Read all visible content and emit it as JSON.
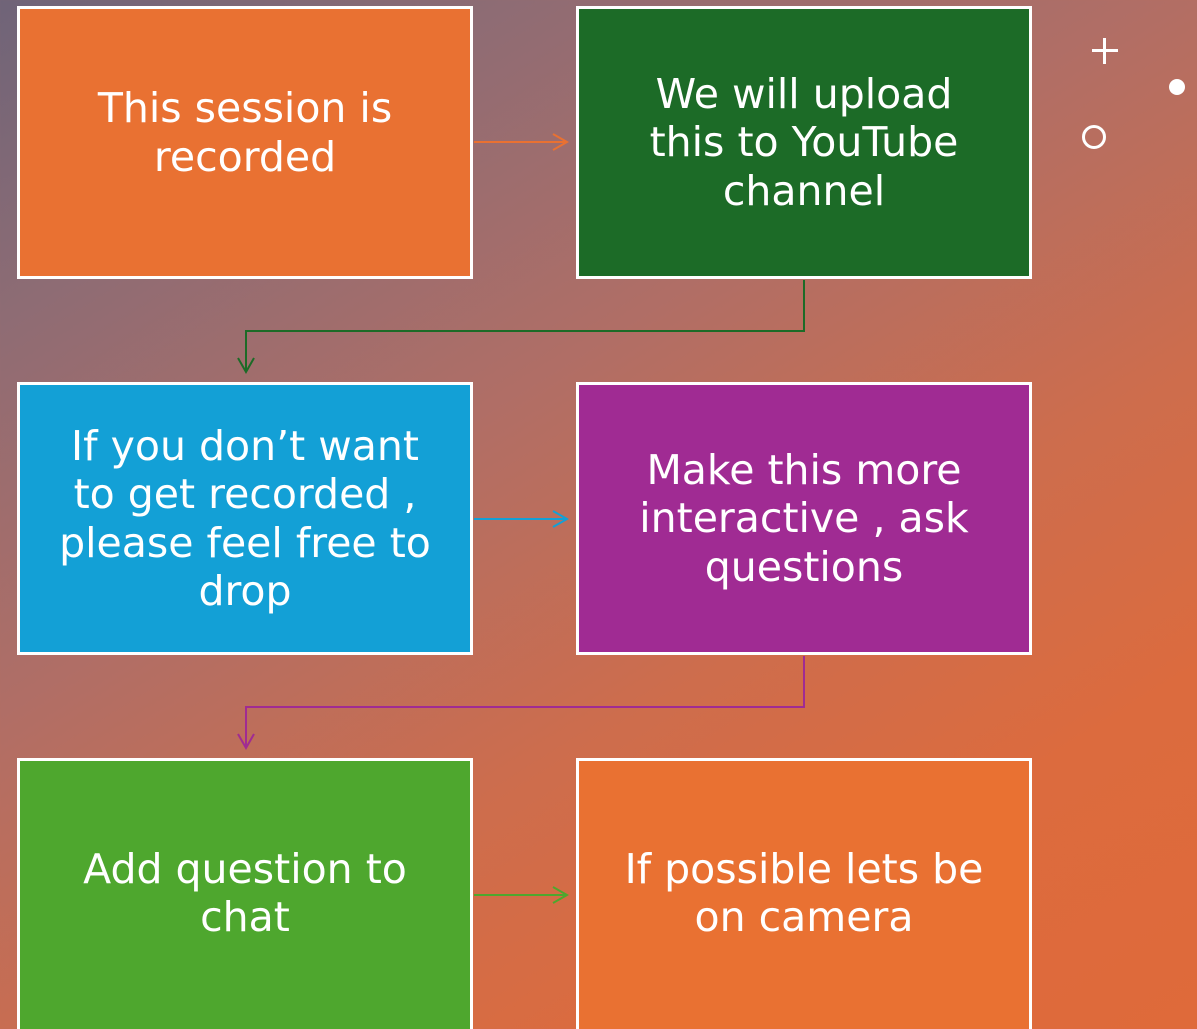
{
  "boxes": [
    {
      "text": "This session is\nrecorded",
      "color": "#e97132"
    },
    {
      "text": "We will upload\nthis to YouTube\nchannel",
      "color": "#1c6b27"
    },
    {
      "text": "If you don’t want\nto get recorded ,\nplease feel free to\ndrop",
      "color": "#13a0d6"
    },
    {
      "text": "Make this more\ninteractive , ask\nquestions",
      "color": "#a02b93"
    },
    {
      "text": "Add question to\nchat",
      "color": "#4ea72e"
    },
    {
      "text": "If possible lets be\non camera",
      "color": "#e97132"
    }
  ],
  "connector_colors": {
    "box1_to_box2": "#e97132",
    "box2_to_box3": "#1c6b27",
    "box3_to_box4": "#13a0d6",
    "box4_to_box5": "#a02b93",
    "box5_to_box6": "#4ea72e"
  },
  "decorations": [
    "plus-icon",
    "filled-circle-icon",
    "hollow-circle-icon"
  ]
}
